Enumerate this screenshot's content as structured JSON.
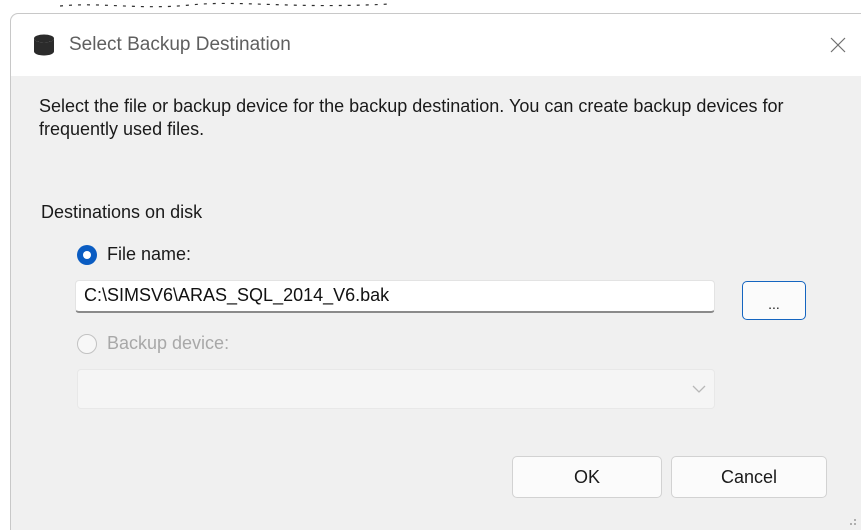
{
  "dialog": {
    "title": "Select Backup Destination",
    "title_icon": "database-icon",
    "close_icon": "close-icon"
  },
  "description": "Select the file or backup device for the backup destination. You can create backup devices for frequently used files.",
  "destinations": {
    "group_label": "Destinations on disk",
    "file_name": {
      "label": "File name:",
      "selected": true,
      "value": "C:\\SIMSV6\\ARAS_SQL_2014_V6.bak"
    },
    "browse_button": {
      "label": "..."
    },
    "backup_device": {
      "label": "Backup device:",
      "selected": false,
      "enabled": false,
      "value": ""
    }
  },
  "buttons": {
    "ok": "OK",
    "cancel": "Cancel"
  },
  "colors": {
    "accent": "#0a5cc2",
    "dialog_bg": "#f0f0f0",
    "disabled_text": "#a8a8a8"
  }
}
